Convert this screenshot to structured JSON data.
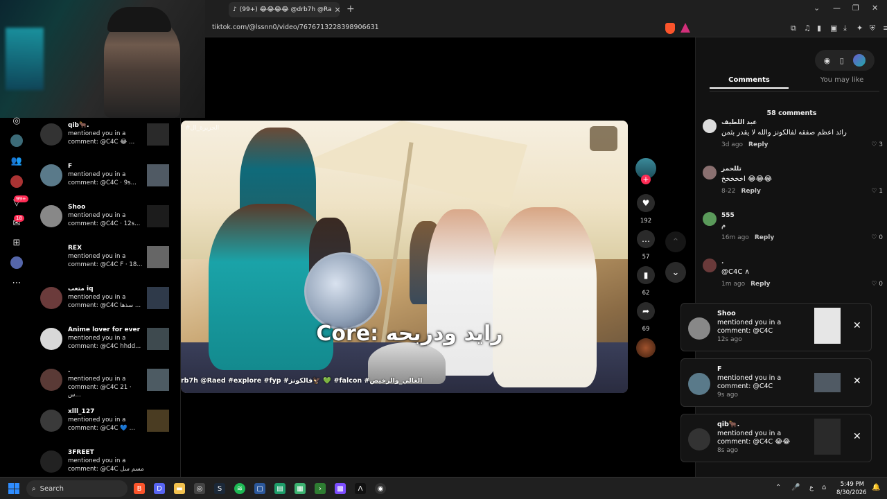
{
  "browser": {
    "tab_title": "(99+) 😂😂😂😂 @drb7h @Ra",
    "url": "tiktok.com/@lssnn0/video/7676713228398906631"
  },
  "nav_badges": {
    "inbox": "99+",
    "messages": "18"
  },
  "inbox": [
    {
      "name": "qib🐂.",
      "text": "mentioned you in a comment: @C4C 😂 ..."
    },
    {
      "name": "F",
      "text": "mentioned you in a comment: @C4C · 9s..."
    },
    {
      "name": "Shoo",
      "text": "mentioned you in a comment: @C4C · 12s..."
    },
    {
      "name": "REX",
      "text": "mentioned you in a comment: @C4C F · 18..."
    },
    {
      "name": "متعب iq",
      "text": "mentioned you in a comment: @C4C سذها ..."
    },
    {
      "name": "Anime lover for ever",
      "text": "mentioned you in a comment: @C4C hhdd..."
    },
    {
      "name": ".",
      "text": "mentioned you in a comment: @C4C 21 · س..."
    },
    {
      "name": "xlll_127",
      "text": "mentioned you in a comment: @C4C 💙 ..."
    },
    {
      "name": "3FREET",
      "text": "mentioned you in a comment: @C4C مسم سل ..."
    }
  ],
  "video": {
    "watermark": "#الجزيرة_ال",
    "caption": "Core: رايد ودربحه",
    "hashtags": "rb7h @Raed #explore #fyp #فالكونز🦅 💚 #falcon #الغالي_والرخيص"
  },
  "actions": {
    "likes": "192",
    "comments": "57",
    "saves": "62",
    "shares": "69"
  },
  "right_panel": {
    "tab_comments": "Comments",
    "tab_you_may_like": "You may like",
    "comment_count": "58 comments",
    "reply_label": "Reply",
    "comments": [
      {
        "name": "عبد اللطيف",
        "text": "رائد اعظم صفقه لفالكونز والله لا يقدر بثمن",
        "time": "3d ago",
        "likes": "3"
      },
      {
        "name": "تللحمز",
        "text": "اخخخخخ 😂😂😂",
        "time": "8-22",
        "likes": "1"
      },
      {
        "name": "555",
        "text": "م",
        "time": "16m ago",
        "likes": "0"
      },
      {
        "name": ".",
        "text": "@C4C ∧",
        "time": "1m ago",
        "likes": "0"
      }
    ]
  },
  "notifications": [
    {
      "name": "Shoo",
      "text": "mentioned you in a comment: @C4C",
      "time": "12s ago"
    },
    {
      "name": "F",
      "text": "mentioned you in a comment: @C4C",
      "time": "9s ago"
    },
    {
      "name": "qib🐂.",
      "text": "mentioned you in a comment: @C4C 😂😂",
      "time": "8s ago"
    }
  ],
  "taskbar": {
    "search_label": "Search",
    "time": "5:49 PM",
    "date": "8/30/2026",
    "lang": "ع"
  }
}
